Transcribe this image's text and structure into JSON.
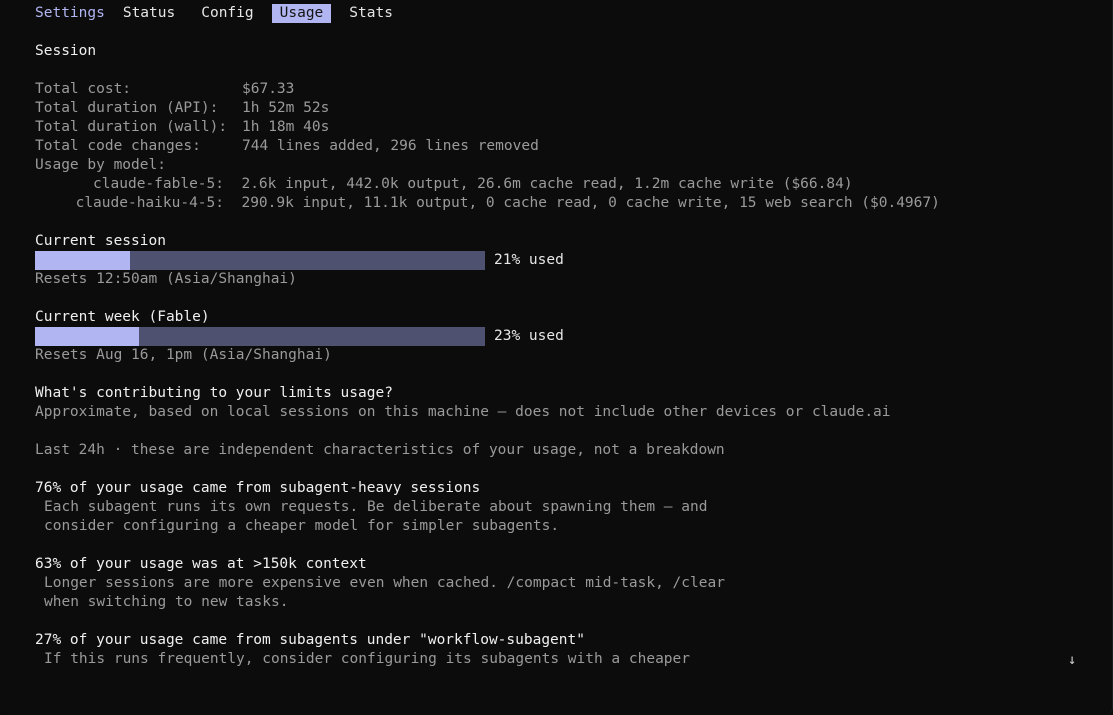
{
  "tabs": {
    "title": "Settings",
    "items": [
      "Status",
      "Config",
      "Usage",
      "Stats"
    ],
    "active": "Usage"
  },
  "session": {
    "heading": "Session",
    "total_cost_label": "Total cost:",
    "total_cost_value": "$67.33",
    "duration_api_label": "Total duration (API):",
    "duration_api_value": "1h 52m 52s",
    "duration_wall_label": "Total duration (wall):",
    "duration_wall_value": "1h 18m 40s",
    "code_changes_label": "Total code changes:",
    "code_changes_value": "744 lines added, 296 lines removed",
    "by_model_label": "Usage by model:",
    "models": [
      {
        "name": "claude-fable-5:",
        "detail": "2.6k input, 442.0k output, 26.6m cache read, 1.2m cache write ($66.84)"
      },
      {
        "name": "claude-haiku-4-5:",
        "detail": "290.9k input, 11.1k output, 0 cache read, 0 cache write, 15 web search ($0.4967)"
      }
    ]
  },
  "limits": {
    "current_session": {
      "title": "Current session",
      "used_percent": 21,
      "used_label": "21% used",
      "reset": "Resets 12:50am (Asia/Shanghai)"
    },
    "current_week": {
      "title": "Current week (Fable)",
      "used_percent": 23,
      "used_label": "23% used",
      "reset": "Resets Aug 16, 1pm (Asia/Shanghai)"
    }
  },
  "contributing": {
    "heading": "What's contributing to your limits usage?",
    "subheading": "Approximate, based on local sessions on this machine — does not include other devices or claude.ai",
    "period_note": "Last 24h · these are independent characteristics of your usage, not a breakdown",
    "insights": [
      {
        "title": "76% of your usage came from subagent-heavy sessions",
        "lines": [
          "Each subagent runs its own requests. Be deliberate about spawning them — and",
          "consider configuring a cheaper model for simpler subagents."
        ]
      },
      {
        "title": "63% of your usage was at >150k context",
        "lines": [
          "Longer sessions are more expensive even when cached. /compact mid-task, /clear",
          "when switching to new tasks."
        ]
      },
      {
        "title": "27% of your usage came from subagents under \"workflow-subagent\"",
        "lines": [
          "If this runs frequently, consider configuring its subagents with a cheaper"
        ]
      }
    ]
  },
  "scroll_indicator": "↓",
  "colors": {
    "background": "#0c0c0d",
    "accent": "#b1b6f2",
    "bar_track": "#4f5170",
    "text_bright": "#f0f0f0",
    "text_dim": "#9a9a9a"
  }
}
